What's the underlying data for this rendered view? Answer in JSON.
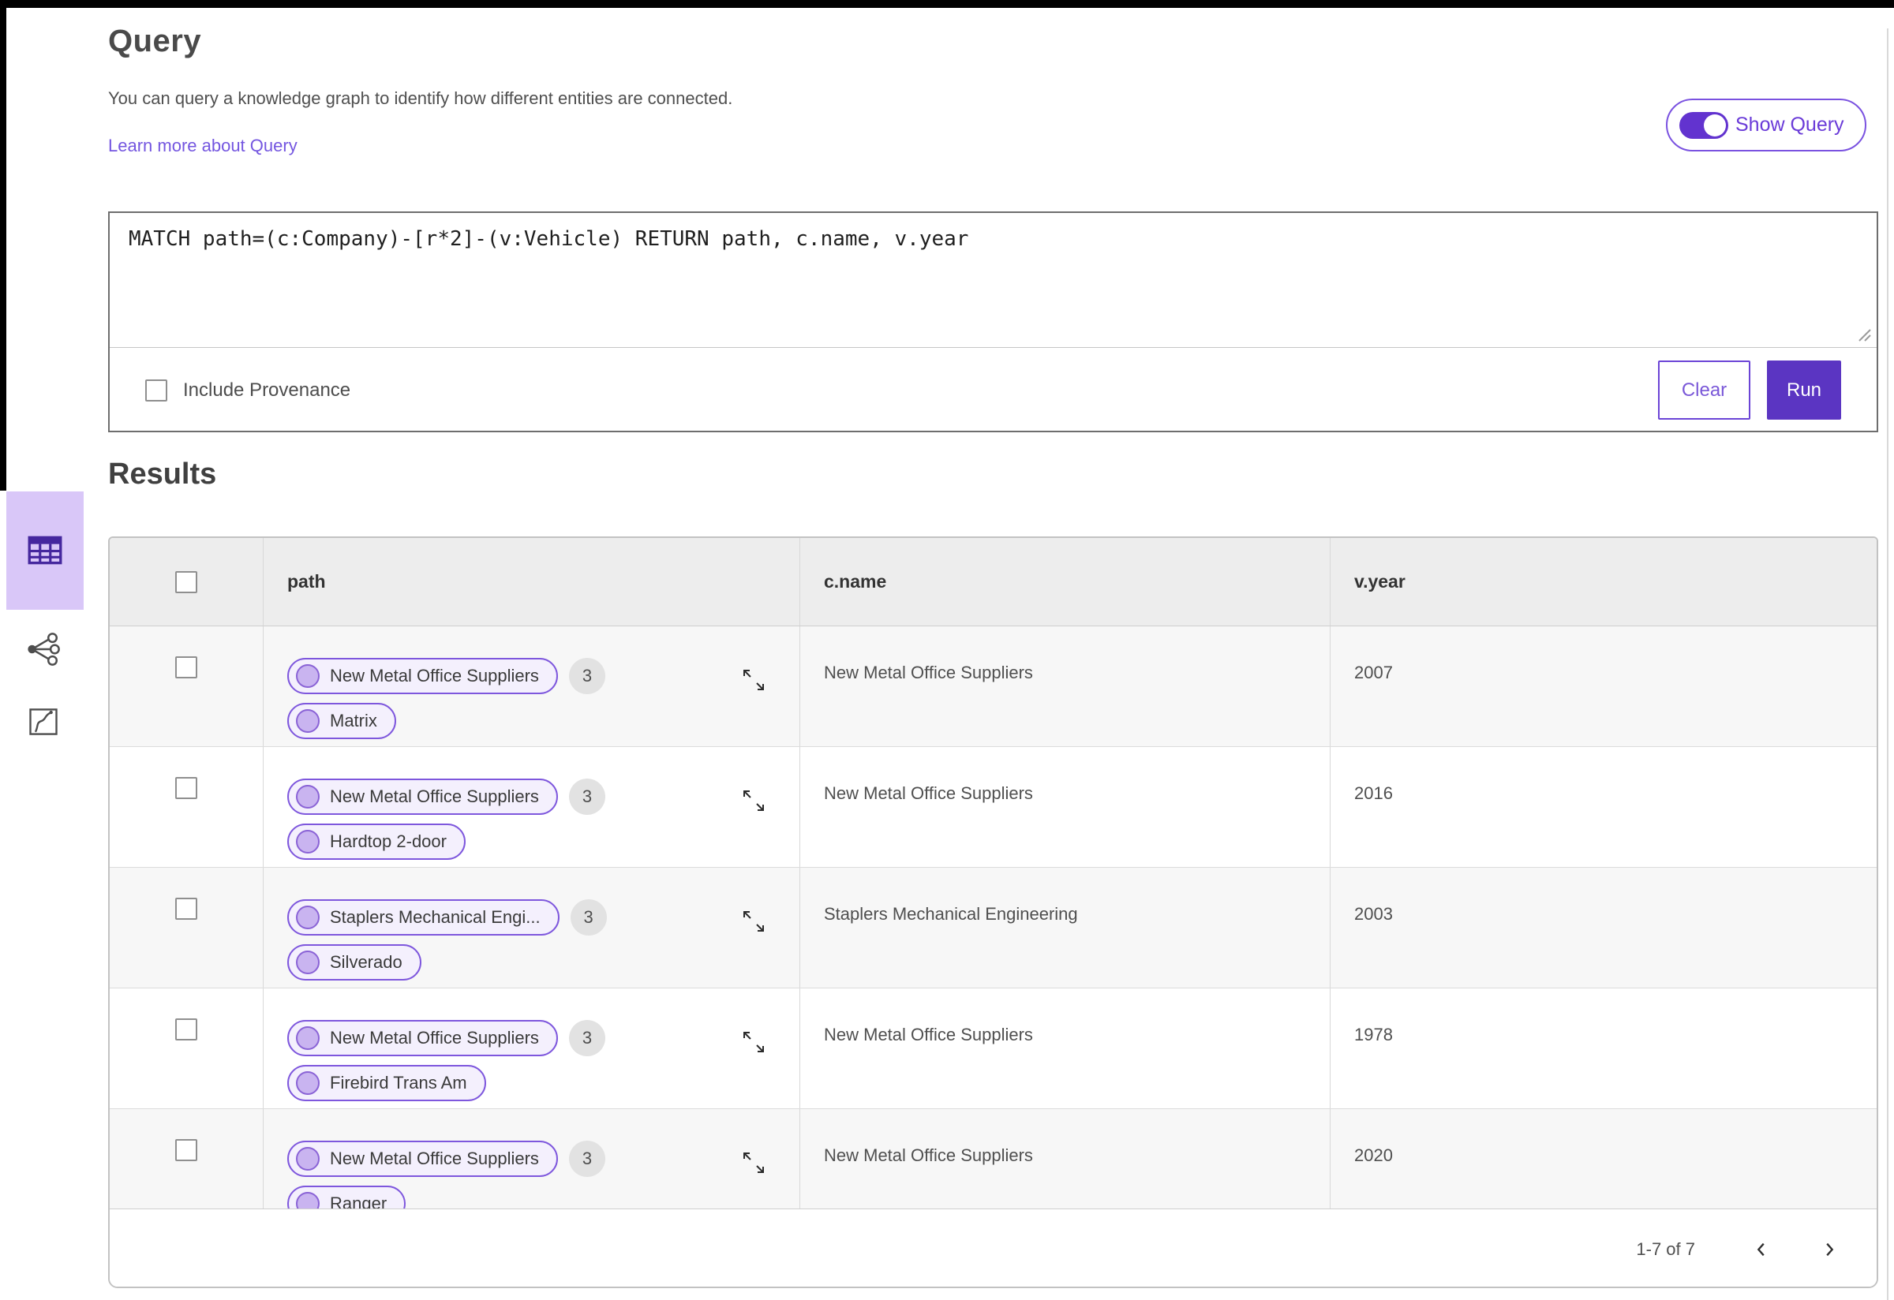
{
  "page": {
    "title": "Query",
    "description": "You can query a knowledge graph to identify how different entities are connected.",
    "learn_more": "Learn more about Query",
    "show_query_label": "Show Query"
  },
  "query_panel": {
    "query_text": "MATCH path=(c:Company)-[r*2]-(v:Vehicle) RETURN path, c.name, v.year",
    "include_provenance_label": "Include Provenance",
    "include_provenance_checked": false,
    "clear_label": "Clear",
    "run_label": "Run"
  },
  "results": {
    "heading": "Results",
    "views": {
      "selected": "table",
      "options": [
        "table",
        "graph",
        "map"
      ]
    },
    "columns": [
      "path",
      "c.name",
      "v.year"
    ],
    "rows": [
      {
        "path_source": "New Metal Office Suppliers",
        "path_badge": "3",
        "path_target": "Matrix",
        "c_name": "New Metal Office Suppliers",
        "v_year": "2007"
      },
      {
        "path_source": "New Metal Office Suppliers",
        "path_badge": "3",
        "path_target": "Hardtop 2-door",
        "c_name": "New Metal Office Suppliers",
        "v_year": "2016"
      },
      {
        "path_source": "Staplers Mechanical Engi...",
        "path_badge": "3",
        "path_target": "Silverado",
        "c_name": "Staplers Mechanical Engineering",
        "v_year": "2003"
      },
      {
        "path_source": "New Metal Office Suppliers",
        "path_badge": "3",
        "path_target": "Firebird Trans Am",
        "c_name": "New Metal Office Suppliers",
        "v_year": "1978"
      },
      {
        "path_source": "New Metal Office Suppliers",
        "path_badge": "3",
        "path_target": "Ranger",
        "c_name": "New Metal Office Suppliers",
        "v_year": "2020"
      }
    ],
    "pagination": {
      "label": "1-7 of 7"
    }
  },
  "colors": {
    "accent": "#5b35c2",
    "accent_light": "#7a52e0",
    "pill_border": "#7e57dd",
    "pill_bg": "#f4f0fd",
    "node_fill": "#c9b4f0",
    "selected_tile_bg": "#d9c7f8",
    "selected_icon": "#45279e",
    "header_bg": "#ededed",
    "row_alt_bg": "#f7f7f7"
  }
}
